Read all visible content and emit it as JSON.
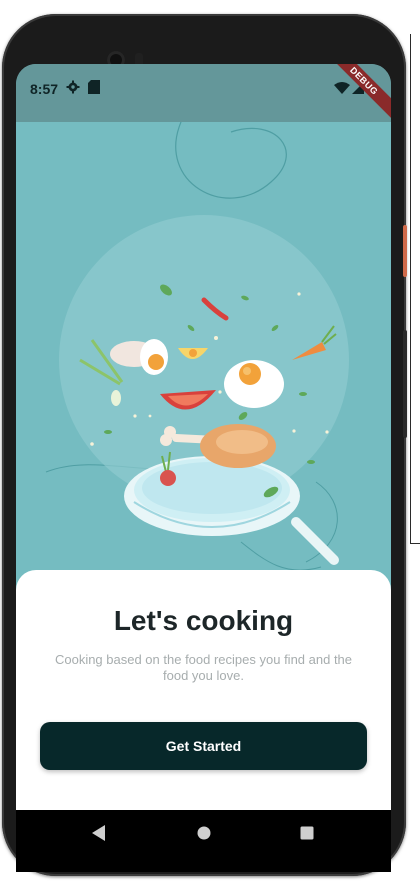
{
  "status_bar": {
    "time": "8:57",
    "debug_label": "DEBUG"
  },
  "onboarding": {
    "title": "Let's cooking",
    "subtitle": "Cooking based on the food recipes you find and the food you love.",
    "cta_label": "Get Started"
  },
  "nav_bar": {
    "buttons": [
      "back-icon",
      "home-icon",
      "recents-icon"
    ]
  },
  "colors": {
    "screen_background": "#75bcc1",
    "status_bar": "#64979a",
    "button": "#07282a",
    "card": "#ffffff"
  }
}
